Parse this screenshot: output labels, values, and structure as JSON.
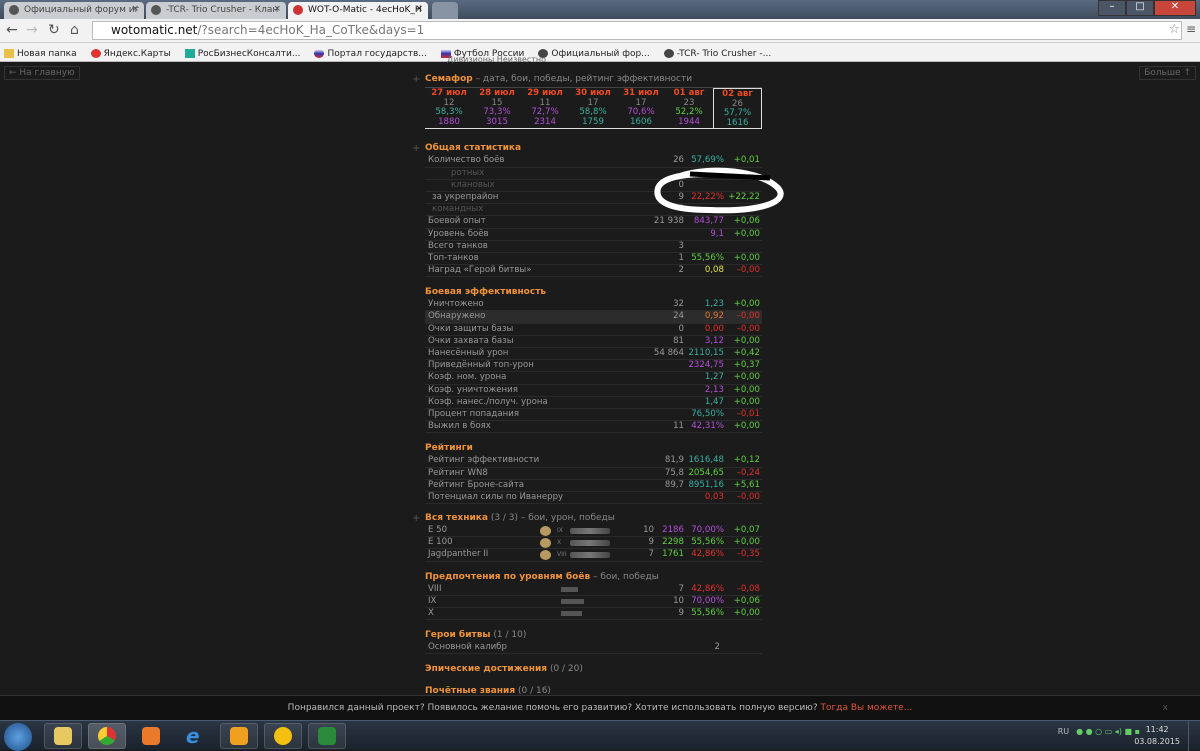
{
  "browser": {
    "tabs": [
      "Официальный форум иг",
      "-TCR- Trio Crusher - Клан",
      "WOT-O-Matic - 4ecHoK_Н"
    ],
    "url_host": "wotomatic.net",
    "url_path": "/?search=4ecHoK_Ha_CoTke&days=1",
    "bookmarks": [
      "Новая папка",
      "Яндекс.Карты",
      "РосБизнесКонсалти...",
      "Портал государств...",
      "Футбол России",
      "Официальный фор...",
      "-TCR- Trio Crusher -..."
    ]
  },
  "page": {
    "back_label": "← На главную",
    "more_label": "Больше ↑",
    "subtitle": "Дивизионы Неизвестно",
    "semafor": {
      "title": "Семафор",
      "desc": " – дата, бои, победы, рейтинг эффективности",
      "days": [
        {
          "date": "27 июл",
          "battles": "12",
          "wr": "58,3%",
          "wrc": "teal",
          "eff": "1880",
          "effc": "purple"
        },
        {
          "date": "28 июл",
          "battles": "15",
          "wr": "73,3%",
          "wrc": "purple",
          "eff": "3015",
          "effc": "purple"
        },
        {
          "date": "29 июл",
          "battles": "11",
          "wr": "72,7%",
          "wrc": "purple",
          "eff": "2314",
          "effc": "purple"
        },
        {
          "date": "30 июл",
          "battles": "17",
          "wr": "58,8%",
          "wrc": "teal",
          "eff": "1759",
          "effc": "teal"
        },
        {
          "date": "31 июл",
          "battles": "17",
          "wr": "70,6%",
          "wrc": "purple",
          "eff": "1606",
          "effc": "teal"
        },
        {
          "date": "01 авг",
          "battles": "23",
          "wr": "52,2%",
          "wrc": "green",
          "eff": "1944",
          "effc": "purple"
        },
        {
          "date": "02 авг",
          "battles": "26",
          "wr": "57,7%",
          "wrc": "teal",
          "eff": "1616",
          "effc": "teal"
        }
      ]
    },
    "general": {
      "title": "Общая статистика",
      "rows": [
        {
          "l": "Количество боёв",
          "c": "26",
          "v": "57,69%",
          "vc": "teal",
          "d": "+0,01",
          "dc": "green"
        },
        {
          "l": "ротных",
          "ind": "i2"
        },
        {
          "l": "клановых",
          "ind": "i2",
          "c": "0"
        },
        {
          "l": "за укрепрайон",
          "ind": "i1",
          "c": "9",
          "v": "22,22%",
          "vc": "red",
          "d": "+22,22",
          "dc": "green"
        },
        {
          "l": "командных",
          "ind": "i3",
          "c": "0"
        },
        {
          "l": "Боевой опыт",
          "c": "21 938",
          "v": "843,77",
          "vc": "purple",
          "d": "+0,06",
          "dc": "green"
        },
        {
          "l": "Уровень боёв",
          "v": "9,1",
          "vc": "purple",
          "d": "+0,00",
          "dc": "green"
        },
        {
          "l": "Всего танков",
          "c": "3"
        },
        {
          "l": "Топ-танков",
          "c": "1",
          "v": "55,56%",
          "vc": "green",
          "d": "+0,00",
          "dc": "green"
        },
        {
          "l": "Наград «Герой битвы»",
          "c": "2",
          "v": "0,08",
          "vc": "yellow",
          "d": "–0,00",
          "dc": "red"
        }
      ]
    },
    "combat": {
      "title": "Боевая эффективность",
      "rows": [
        {
          "l": "Уничтожено",
          "c": "32",
          "v": "1,23",
          "vc": "teal",
          "d": "+0,00",
          "dc": "green"
        },
        {
          "l": "Обнаружено",
          "c": "24",
          "v": "0,92",
          "vc": "orange",
          "d": "–0,00",
          "dc": "red",
          "hl": true
        },
        {
          "l": "Очки защиты базы",
          "c": "0",
          "v": "0,00",
          "vc": "red",
          "d": "–0,00",
          "dc": "red"
        },
        {
          "l": "Очки захвата базы",
          "c": "81",
          "v": "3,12",
          "vc": "purple",
          "d": "+0,00",
          "dc": "green"
        },
        {
          "l": "Нанесённый урон",
          "c": "54 864",
          "v": "2110,15",
          "vc": "teal",
          "d": "+0,42",
          "dc": "green"
        },
        {
          "l": "Приведённый топ-урон",
          "v": "2324,75",
          "vc": "purple",
          "d": "+0,37",
          "dc": "green"
        },
        {
          "l": "Коэф. ном. урона",
          "v": "1,27",
          "vc": "teal",
          "d": "+0,00",
          "dc": "green"
        },
        {
          "l": "Коэф. уничтожения",
          "v": "2,13",
          "vc": "purple",
          "d": "+0,00",
          "dc": "green"
        },
        {
          "l": "Коэф. нанес./получ. урона",
          "v": "1,47",
          "vc": "teal",
          "d": "+0,00",
          "dc": "green"
        },
        {
          "l": "Процент попадания",
          "v": "76,50%",
          "vc": "teal",
          "d": "–0,01",
          "dc": "red"
        },
        {
          "l": "Выжил в боях",
          "c": "11",
          "v": "42,31%",
          "vc": "purple",
          "d": "+0,00",
          "dc": "green"
        }
      ]
    },
    "ratings": {
      "title": "Рейтинги",
      "rows": [
        {
          "l": "Рейтинг эффективности",
          "c": "81,9",
          "v": "1616,48",
          "vc": "teal",
          "d": "+0,12",
          "dc": "green"
        },
        {
          "l": "Рейтинг WN8",
          "c": "75,8",
          "v": "2054,65",
          "vc": "green",
          "d": "–0,24",
          "dc": "red"
        },
        {
          "l": "Рейтинг Броне-сайта",
          "c": "89,7",
          "v": "8951,16",
          "vc": "teal",
          "d": "+5,61",
          "dc": "green"
        },
        {
          "l": "Потенциал силы по Иванерру",
          "v": "0,03",
          "vc": "red",
          "d": "–0,00",
          "dc": "red"
        }
      ]
    },
    "tanks": {
      "title": "Вся техника",
      "count": " (3 / 3)",
      "desc": " – бои, урон, победы",
      "rows": [
        {
          "l": "E 50",
          "tier": "IX",
          "c": "10",
          "dmg": "2186",
          "dmgc": "purple",
          "v": "70,00%",
          "vc": "purple",
          "d": "+0,07",
          "dc": "green"
        },
        {
          "l": "E 100",
          "tier": "X",
          "c": "9",
          "dmg": "2298",
          "dmgc": "green",
          "v": "55,56%",
          "vc": "green",
          "d": "+0,00",
          "dc": "green"
        },
        {
          "l": "Jagdpanther II",
          "tier": "VIII",
          "c": "7",
          "dmg": "1761",
          "dmgc": "green",
          "v": "42,86%",
          "vc": "red",
          "d": "–0,35",
          "dc": "red"
        }
      ]
    },
    "levels": {
      "title": "Предпочтения по уровням боёв",
      "desc": " – бои, победы",
      "rows": [
        {
          "l": "VIII",
          "bar": 17,
          "c": "7",
          "v": "42,86%",
          "vc": "red",
          "d": "–0,08",
          "dc": "red"
        },
        {
          "l": "IX",
          "bar": 23,
          "c": "10",
          "v": "70,00%",
          "vc": "purple",
          "d": "+0,06",
          "dc": "green"
        },
        {
          "l": "X",
          "bar": 21,
          "c": "9",
          "v": "55,56%",
          "vc": "green",
          "d": "+0,00",
          "dc": "green"
        }
      ]
    },
    "heroes": {
      "title": "Герои битвы",
      "count": " (1 / 10)",
      "rows": [
        {
          "l": "Основной калибр",
          "c2": "2"
        }
      ]
    },
    "epic": {
      "title": "Эпические достижения",
      "count": " (0 / 20)"
    },
    "honor": {
      "title": "Почётные звания",
      "count": " (0 / 16)"
    }
  },
  "notification": {
    "text": "Понравился данный проект? Появилось желание помочь его развитию? Хотите использовать полную версию? ",
    "link": "Тогда Вы можете...",
    "close": "x"
  },
  "taskbar": {
    "lang": "RU",
    "time": "11:42",
    "date": "03.08.2015"
  }
}
